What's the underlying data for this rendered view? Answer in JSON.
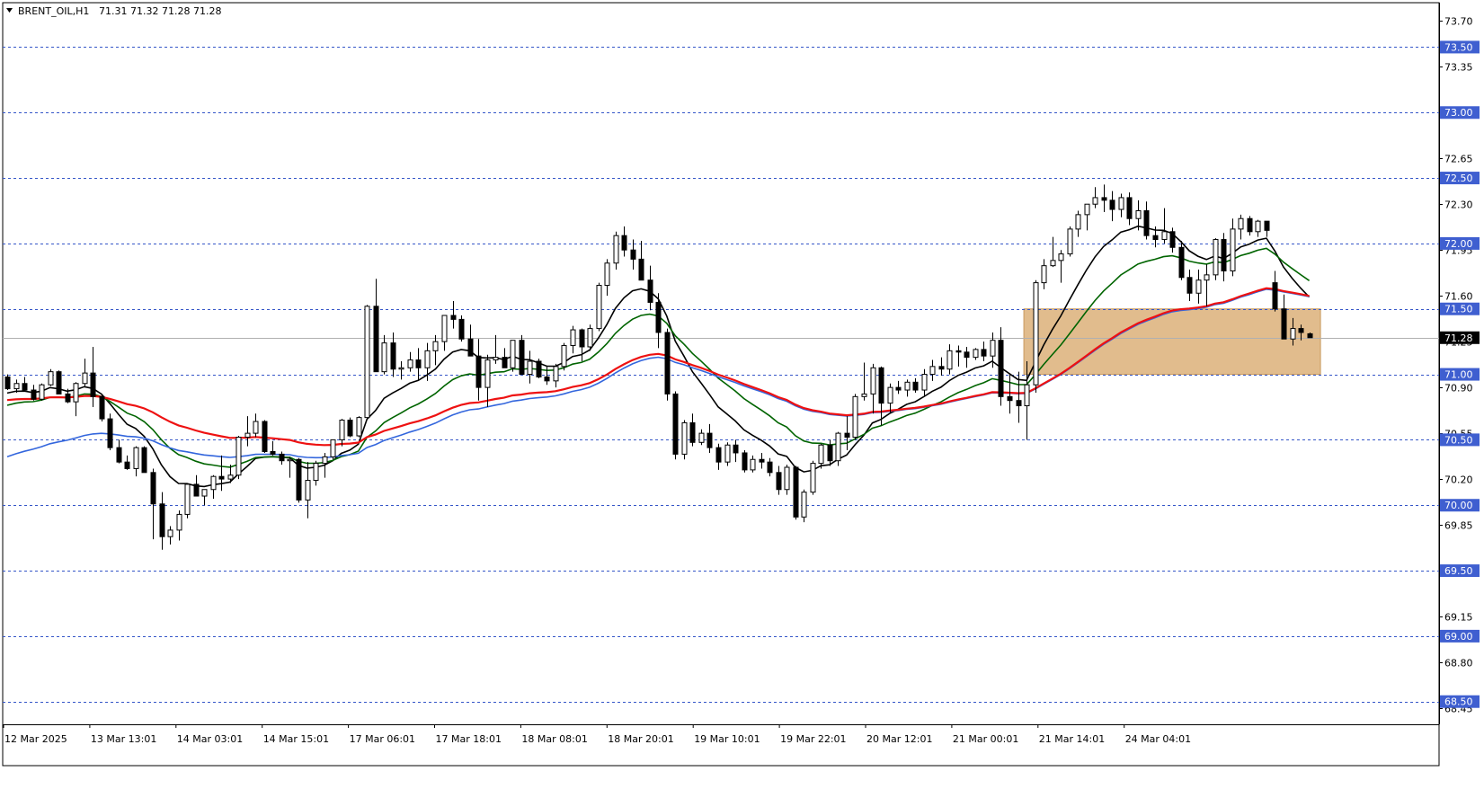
{
  "header": {
    "symbol_label": "BRENT_OIL,H1",
    "ohlc_label": "71.31 71.32 71.28 71.28"
  },
  "chart_data": {
    "type": "candlestick",
    "symbol": "BRENT_OIL",
    "timeframe": "H1",
    "ylim": [
      68.45,
      73.75
    ],
    "y_ticks": [
      73.7,
      73.35,
      72.65,
      72.3,
      71.95,
      71.6,
      71.25,
      70.9,
      70.55,
      70.2,
      69.85,
      69.15,
      68.8,
      68.45
    ],
    "x_ticks": [
      "12 Mar 2025",
      "13 Mar 13:01",
      "14 Mar 03:01",
      "14 Mar 15:01",
      "17 Mar 06:01",
      "17 Mar 18:01",
      "18 Mar 08:01",
      "18 Mar 20:01",
      "19 Mar 10:01",
      "19 Mar 22:01",
      "20 Mar 12:01",
      "21 Mar 00:01",
      "21 Mar 14:01",
      "24 Mar 04:01"
    ],
    "levels": [
      {
        "value": 73.5,
        "label": "73.50"
      },
      {
        "value": 73.0,
        "label": "73.00"
      },
      {
        "value": 72.5,
        "label": "72.50"
      },
      {
        "value": 72.0,
        "label": "72.00"
      },
      {
        "value": 71.5,
        "label": "71.50"
      },
      {
        "value": 71.0,
        "label": "71.00"
      },
      {
        "value": 70.5,
        "label": "70.50"
      },
      {
        "value": 70.0,
        "label": "70.00"
      },
      {
        "value": 69.5,
        "label": "69.50"
      },
      {
        "value": 69.0,
        "label": "69.00"
      },
      {
        "value": 68.5,
        "label": "68.50"
      }
    ],
    "current_price": {
      "value": 71.28,
      "label": "71.28"
    },
    "zone": {
      "from_bar": 119,
      "to_bar": 153,
      "low": 71.0,
      "high": 71.5,
      "color": "#dfb887"
    },
    "candles": [
      [
        70.98,
        71.0,
        70.88,
        70.89
      ],
      [
        70.89,
        70.96,
        70.86,
        70.93
      ],
      [
        70.93,
        70.98,
        70.87,
        70.88
      ],
      [
        70.88,
        70.92,
        70.8,
        70.81
      ],
      [
        70.81,
        70.93,
        70.8,
        70.92
      ],
      [
        70.92,
        71.04,
        70.91,
        71.02
      ],
      [
        71.02,
        71.03,
        70.85,
        70.85
      ],
      [
        70.85,
        70.89,
        70.78,
        70.79
      ],
      [
        70.79,
        70.94,
        70.68,
        70.93
      ],
      [
        70.93,
        71.12,
        70.9,
        71.01
      ],
      [
        71.01,
        71.21,
        70.75,
        70.83
      ],
      [
        70.83,
        70.85,
        70.64,
        70.66
      ],
      [
        70.66,
        70.7,
        70.42,
        70.44
      ],
      [
        70.44,
        70.5,
        70.32,
        70.33
      ],
      [
        70.33,
        70.38,
        70.27,
        70.28
      ],
      [
        70.28,
        70.45,
        70.22,
        70.44
      ],
      [
        70.44,
        70.45,
        70.25,
        70.25
      ],
      [
        70.25,
        70.28,
        69.74,
        70.01
      ],
      [
        70.01,
        70.1,
        69.66,
        69.76
      ],
      [
        69.76,
        69.84,
        69.7,
        69.81
      ],
      [
        69.81,
        69.96,
        69.73,
        69.93
      ],
      [
        69.93,
        70.16,
        69.9,
        70.16
      ],
      [
        70.16,
        70.23,
        70.07,
        70.07
      ],
      [
        70.07,
        70.12,
        70.0,
        70.12
      ],
      [
        70.12,
        70.23,
        70.05,
        70.22
      ],
      [
        70.22,
        70.38,
        70.11,
        70.2
      ],
      [
        70.2,
        70.31,
        70.17,
        70.23
      ],
      [
        70.23,
        70.53,
        70.2,
        70.52
      ],
      [
        70.52,
        70.68,
        70.45,
        70.55
      ],
      [
        70.55,
        70.7,
        70.52,
        70.64
      ],
      [
        70.64,
        70.65,
        70.4,
        70.41
      ],
      [
        70.41,
        70.49,
        70.38,
        70.39
      ],
      [
        70.39,
        70.41,
        70.31,
        70.34
      ],
      [
        70.34,
        70.37,
        70.21,
        70.35
      ],
      [
        70.35,
        70.36,
        70.02,
        70.04
      ],
      [
        70.04,
        70.33,
        69.9,
        70.19
      ],
      [
        70.19,
        70.34,
        70.15,
        70.32
      ],
      [
        70.32,
        70.4,
        70.21,
        70.37
      ],
      [
        70.37,
        70.5,
        70.35,
        70.5
      ],
      [
        70.5,
        70.66,
        70.45,
        70.65
      ],
      [
        70.65,
        70.67,
        70.52,
        70.53
      ],
      [
        70.53,
        70.68,
        70.52,
        70.67
      ],
      [
        70.67,
        71.53,
        70.86,
        71.52
      ],
      [
        71.52,
        71.73,
        71.22,
        71.02
      ],
      [
        71.02,
        71.3,
        71.0,
        71.24
      ],
      [
        71.24,
        71.32,
        70.98,
        71.04
      ],
      [
        71.04,
        71.1,
        70.96,
        71.05
      ],
      [
        71.05,
        71.17,
        71.02,
        71.11
      ],
      [
        71.11,
        71.2,
        70.95,
        71.05
      ],
      [
        71.05,
        71.24,
        70.95,
        71.18
      ],
      [
        71.18,
        71.3,
        71.07,
        71.25
      ],
      [
        71.25,
        71.45,
        71.18,
        71.45
      ],
      [
        71.45,
        71.56,
        71.35,
        71.42
      ],
      [
        71.42,
        71.45,
        71.25,
        71.27
      ],
      [
        71.27,
        71.38,
        71.14,
        71.14
      ],
      [
        71.14,
        71.27,
        70.8,
        70.9
      ],
      [
        70.9,
        71.15,
        70.75,
        71.11
      ],
      [
        71.11,
        71.3,
        71.08,
        71.13
      ],
      [
        71.13,
        71.2,
        71.05,
        71.05
      ],
      [
        71.05,
        71.26,
        71.02,
        71.26
      ],
      [
        71.26,
        71.3,
        71.0,
        71.0
      ],
      [
        71.0,
        71.18,
        70.93,
        71.1
      ],
      [
        71.1,
        71.12,
        70.97,
        70.98
      ],
      [
        70.98,
        71.06,
        70.92,
        70.95
      ],
      [
        70.95,
        71.08,
        70.9,
        71.06
      ],
      [
        71.06,
        71.24,
        71.03,
        71.22
      ],
      [
        71.22,
        71.37,
        71.16,
        71.34
      ],
      [
        71.34,
        71.35,
        71.1,
        71.21
      ],
      [
        71.21,
        71.38,
        71.18,
        71.35
      ],
      [
        71.35,
        71.7,
        71.33,
        71.68
      ],
      [
        71.68,
        71.88,
        71.6,
        71.85
      ],
      [
        71.85,
        72.09,
        71.8,
        72.06
      ],
      [
        72.06,
        72.13,
        71.9,
        71.95
      ],
      [
        71.95,
        72.03,
        71.8,
        71.88
      ],
      [
        71.88,
        72.02,
        71.72,
        71.72
      ],
      [
        71.72,
        71.83,
        71.49,
        71.55
      ],
      [
        71.55,
        71.62,
        71.2,
        71.32
      ],
      [
        71.32,
        71.35,
        70.8,
        70.85
      ],
      [
        70.85,
        70.87,
        70.35,
        70.39
      ],
      [
        70.39,
        70.65,
        70.35,
        70.63
      ],
      [
        70.63,
        70.7,
        70.45,
        70.48
      ],
      [
        70.48,
        70.58,
        70.46,
        70.55
      ],
      [
        70.55,
        70.62,
        70.4,
        70.44
      ],
      [
        70.44,
        70.47,
        70.27,
        70.33
      ],
      [
        70.33,
        70.48,
        70.3,
        70.46
      ],
      [
        70.46,
        70.5,
        70.33,
        70.4
      ],
      [
        70.4,
        70.42,
        70.25,
        70.27
      ],
      [
        70.27,
        70.38,
        70.25,
        70.35
      ],
      [
        70.35,
        70.4,
        70.28,
        70.33
      ],
      [
        70.33,
        70.36,
        70.22,
        70.25
      ],
      [
        70.25,
        70.3,
        70.08,
        70.12
      ],
      [
        70.12,
        70.31,
        70.08,
        70.29
      ],
      [
        70.29,
        70.3,
        69.89,
        69.91
      ],
      [
        69.91,
        70.12,
        69.87,
        70.1
      ],
      [
        70.1,
        70.34,
        70.08,
        70.32
      ],
      [
        70.32,
        70.47,
        70.28,
        70.46
      ],
      [
        70.46,
        70.5,
        70.3,
        70.34
      ],
      [
        70.34,
        70.56,
        70.3,
        70.55
      ],
      [
        70.55,
        70.68,
        70.42,
        70.52
      ],
      [
        70.52,
        70.85,
        70.5,
        70.83
      ],
      [
        70.83,
        71.09,
        70.8,
        70.85
      ],
      [
        70.85,
        71.08,
        70.7,
        71.05
      ],
      [
        71.05,
        71.06,
        70.61,
        70.78
      ],
      [
        70.78,
        70.93,
        70.7,
        70.9
      ],
      [
        70.9,
        70.95,
        70.85,
        70.88
      ],
      [
        70.88,
        70.96,
        70.83,
        70.94
      ],
      [
        70.94,
        70.97,
        70.86,
        70.88
      ],
      [
        70.88,
        71.04,
        70.83,
        71.0
      ],
      [
        71.0,
        71.11,
        70.95,
        71.06
      ],
      [
        71.06,
        71.13,
        70.99,
        71.04
      ],
      [
        71.04,
        71.23,
        71.0,
        71.18
      ],
      [
        71.18,
        71.22,
        71.06,
        71.17
      ],
      [
        71.17,
        71.21,
        71.05,
        71.13
      ],
      [
        71.13,
        71.2,
        71.11,
        71.19
      ],
      [
        71.19,
        71.25,
        71.1,
        71.14
      ],
      [
        71.14,
        71.32,
        71.05,
        71.26
      ],
      [
        71.26,
        71.36,
        70.76,
        70.83
      ],
      [
        70.83,
        71.0,
        70.7,
        70.8
      ],
      [
        70.8,
        71.02,
        70.63,
        70.76
      ],
      [
        70.76,
        71.1,
        70.5,
        70.92
      ],
      [
        70.92,
        71.72,
        70.86,
        71.7
      ],
      [
        71.7,
        71.88,
        71.65,
        71.83
      ],
      [
        71.83,
        72.05,
        71.82,
        71.87
      ],
      [
        71.87,
        71.95,
        71.7,
        71.92
      ],
      [
        71.92,
        72.13,
        71.9,
        72.11
      ],
      [
        72.11,
        72.25,
        72.05,
        72.22
      ],
      [
        72.22,
        72.3,
        72.1,
        72.3
      ],
      [
        72.3,
        72.43,
        72.27,
        72.35
      ],
      [
        72.35,
        72.45,
        72.24,
        72.33
      ],
      [
        72.33,
        72.4,
        72.17,
        72.26
      ],
      [
        72.26,
        72.38,
        72.2,
        72.35
      ],
      [
        72.35,
        72.39,
        72.14,
        72.19
      ],
      [
        72.19,
        72.33,
        72.1,
        72.25
      ],
      [
        72.25,
        72.32,
        72.03,
        72.06
      ],
      [
        72.06,
        72.13,
        71.97,
        72.03
      ],
      [
        72.03,
        72.27,
        72.0,
        72.09
      ],
      [
        72.09,
        72.12,
        71.93,
        71.97
      ],
      [
        71.97,
        72.02,
        71.72,
        71.74
      ],
      [
        71.74,
        71.8,
        71.56,
        71.62
      ],
      [
        71.62,
        71.8,
        71.54,
        71.72
      ],
      [
        71.72,
        71.84,
        71.52,
        71.76
      ],
      [
        71.76,
        72.04,
        71.72,
        72.03
      ],
      [
        72.03,
        72.08,
        71.71,
        71.79
      ],
      [
        71.79,
        72.19,
        71.75,
        72.11
      ],
      [
        72.11,
        72.22,
        72.03,
        72.19
      ],
      [
        72.19,
        72.21,
        72.06,
        72.09
      ],
      [
        72.09,
        72.18,
        72.05,
        72.17
      ],
      [
        72.17,
        72.16,
        72.05,
        72.1
      ],
      [
        71.7,
        71.79,
        71.48,
        71.5
      ],
      [
        71.5,
        71.61,
        71.29,
        71.27
      ],
      [
        71.27,
        71.43,
        71.22,
        71.35
      ],
      [
        71.35,
        71.38,
        71.26,
        71.32
      ],
      [
        71.31,
        71.32,
        71.28,
        71.28
      ]
    ],
    "series": [
      {
        "name": "",
        "color": "#000000",
        "period": 10,
        "width": 1.6
      },
      {
        "name": "",
        "color": "#006400",
        "period": 20,
        "width": 1.6
      },
      {
        "name": "",
        "color": "#3366dd",
        "period": 50,
        "width": 1.6
      },
      {
        "name": "",
        "color": "#ee1111",
        "period": 200,
        "width": 2.2
      }
    ],
    "colors": {
      "bull_fill": "#ffffff",
      "bear_fill": "#000000",
      "level_line": "#3556c8",
      "label_bg": "#3f5fd0",
      "label_text": "#ffffff"
    }
  }
}
